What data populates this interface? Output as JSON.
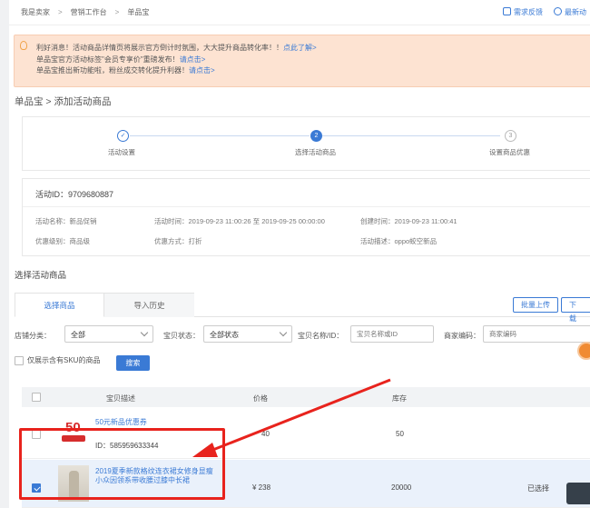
{
  "breadcrumb": {
    "item1": "我是卖家",
    "item2": "营销工作台",
    "item3": "单品宝",
    "sep": ">"
  },
  "topbar": {
    "feedback": "需求反馈",
    "news": "最新动"
  },
  "notice": {
    "line1_text": "利好消息！活动商品详情页将展示官方倒计时氛围，大大提升商品转化率！！",
    "line1_link": "点此了解>",
    "line2_text": "单品宝官方活动标签\"会员专享价\"重磅发布！",
    "line2_link": "请点击>",
    "line3_text": "单品宝推出新功能啦，粉丝成交转化提升利器！",
    "line3_link": "请点击>"
  },
  "page_title": "单品宝 > 添加活动商品",
  "steps": [
    {
      "icon": "✓",
      "label": "活动设置",
      "state": "done"
    },
    {
      "icon": "2",
      "label": "选择活动商品",
      "state": "active"
    },
    {
      "icon": "3",
      "label": "设置商品优惠",
      "state": "todo"
    }
  ],
  "activity": {
    "id": "活动ID：9709680887",
    "name": "活动名称：新品促销",
    "time": "活动时间：2019-09-23 11:00:26 至 2019-09-25 00:00:00",
    "created": "创建时间：2019-09-23 11:00:41",
    "level": "优惠级别：商品级",
    "method": "优惠方式：打折",
    "desc": "活动描述：oppo蛟空新品"
  },
  "select_title": "选择活动商品",
  "tabs": {
    "select": "选择商品",
    "history": "导入历史"
  },
  "buttons": {
    "bulk_upload": "批量上传",
    "download": "下载",
    "search": "搜索"
  },
  "filters": {
    "shop_cat_label": "店铺分类：",
    "shop_cat_value": "全部",
    "status_label": "宝贝状态：",
    "status_value": "全部状态",
    "name_label": "宝贝名称/ID：",
    "name_placeholder": "宝贝名称或ID",
    "code_label": "商家编码：",
    "code_placeholder": "商家编码",
    "sku_only": "仅展示含有SKU的商品"
  },
  "table": {
    "headers": {
      "desc": "宝贝描述",
      "price": "价格",
      "stock": "库存"
    },
    "rows": [
      {
        "title": "50元新品优惠券",
        "id": "ID：585959633344",
        "price": "40",
        "stock": "50",
        "status": "",
        "checked": false,
        "thumb_text": "50"
      },
      {
        "title": "2019夏季新款格纹连衣裙女修身显瘦小众因领系带收腰过膝中长裙",
        "id": "",
        "price": "¥ 238",
        "stock": "20000",
        "status": "已选择",
        "checked": true
      }
    ]
  },
  "colors": {
    "accent": "#3a7ad5",
    "highlight": "#e8231d",
    "notice_bg": "#fde3d2"
  }
}
